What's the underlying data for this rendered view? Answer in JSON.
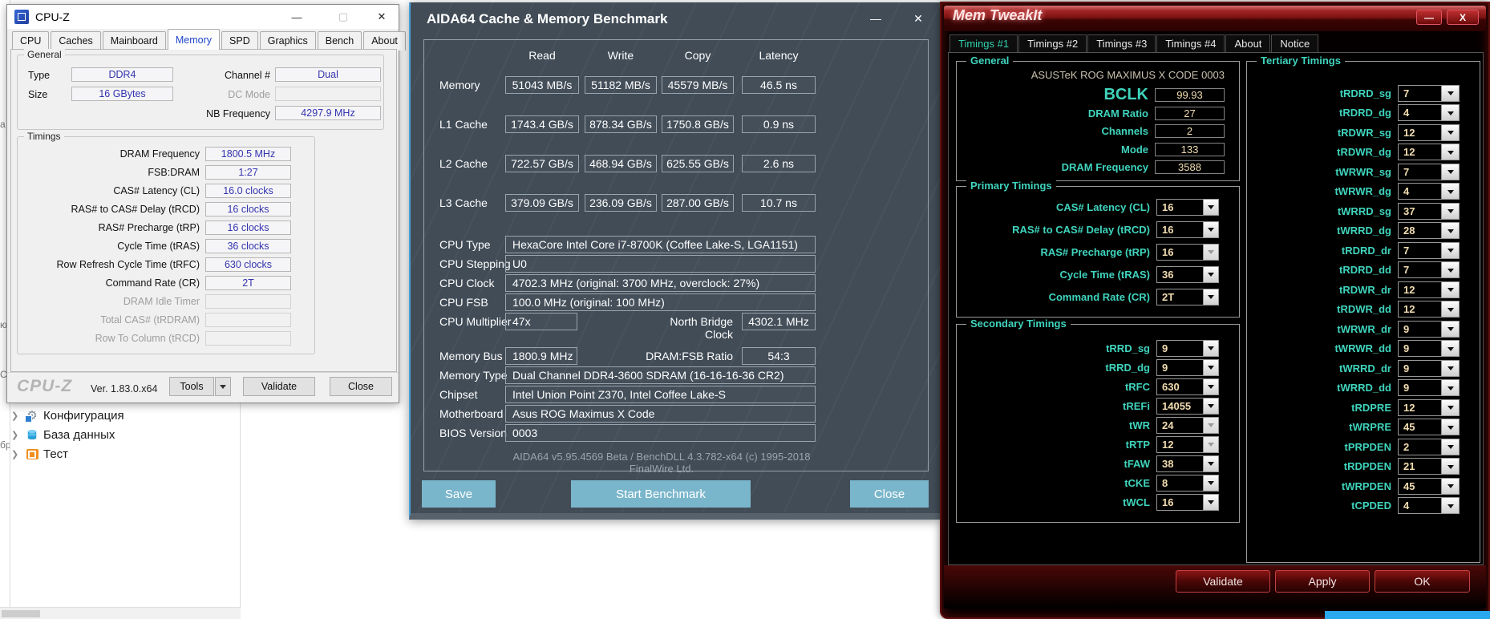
{
  "icons": {
    "minimize": "—",
    "maximize": "▢",
    "close": "✕",
    "close_x": "X",
    "dropdown": "▼",
    "chevron": "❯"
  },
  "colors": {
    "taskbar_blue": "#29a8ee",
    "aida_button": "#7ab6cb",
    "mti_teal": "#3fd4bd",
    "mti_value": "#f2ddb0",
    "cpuz_value": "#3434ae"
  },
  "bg": {
    "fragments": [
      "a",
      "ю",
      "CI",
      "бр"
    ],
    "tree": [
      {
        "label": "Конфигурация"
      },
      {
        "label": "База данных"
      },
      {
        "label": "Тест"
      }
    ]
  },
  "cpuz": {
    "title": "CPU-Z",
    "tabs": [
      "CPU",
      "Caches",
      "Mainboard",
      "Memory",
      "SPD",
      "Graphics",
      "Bench",
      "About"
    ],
    "general_label": "General",
    "type_label": "Type",
    "type_value": "DDR4",
    "size_label": "Size",
    "size_value": "16 GBytes",
    "channel_label": "Channel #",
    "channel_value": "Dual",
    "dc_label": "DC Mode",
    "nb_label": "NB Frequency",
    "nb_value": "4297.9 MHz",
    "timings_label": "Timings",
    "timings": [
      {
        "label": "DRAM Frequency",
        "value": "1800.5 MHz"
      },
      {
        "label": "FSB:DRAM",
        "value": "1:27"
      },
      {
        "label": "CAS# Latency (CL)",
        "value": "16.0 clocks"
      },
      {
        "label": "RAS# to CAS# Delay (tRCD)",
        "value": "16 clocks"
      },
      {
        "label": "RAS# Precharge (tRP)",
        "value": "16 clocks"
      },
      {
        "label": "Cycle Time (tRAS)",
        "value": "36 clocks"
      },
      {
        "label": "Row Refresh Cycle Time (tRFC)",
        "value": "630 clocks"
      },
      {
        "label": "Command Rate (CR)",
        "value": "2T"
      },
      {
        "label": "DRAM Idle Timer",
        "value": ""
      },
      {
        "label": "Total CAS# (tRDRAM)",
        "value": ""
      },
      {
        "label": "Row To Column (tRCD)",
        "value": ""
      }
    ],
    "logo": "CPU-Z",
    "version": "Ver. 1.83.0.x64",
    "tools": "Tools",
    "validate": "Validate",
    "close": "Close"
  },
  "aida": {
    "title": "AIDA64 Cache & Memory Benchmark",
    "headers": [
      "Read",
      "Write",
      "Copy",
      "Latency"
    ],
    "bench": [
      {
        "label": "Memory",
        "v0": "51043 MB/s",
        "v1": "51182 MB/s",
        "v2": "45579 MB/s",
        "v3": "46.5 ns"
      },
      {
        "label": "L1 Cache",
        "v0": "1743.4 GB/s",
        "v1": "878.34 GB/s",
        "v2": "1750.8 GB/s",
        "v3": "0.9 ns"
      },
      {
        "label": "L2 Cache",
        "v0": "722.57 GB/s",
        "v1": "468.94 GB/s",
        "v2": "625.55 GB/s",
        "v3": "2.6 ns"
      },
      {
        "label": "L3 Cache",
        "v0": "379.09 GB/s",
        "v1": "236.09 GB/s",
        "v2": "287.00 GB/s",
        "v3": "10.7 ns"
      }
    ],
    "info": [
      {
        "label": "CPU Type",
        "value": "HexaCore Intel Core i7-8700K  (Coffee Lake-S, LGA1151)"
      },
      {
        "label": "CPU Stepping",
        "value": "U0"
      },
      {
        "label": "CPU Clock",
        "value": "4702.3 MHz  (original: 3700 MHz, overclock: 27%)"
      },
      {
        "label": "CPU FSB",
        "value": "100.0 MHz  (original: 100 MHz)"
      },
      {
        "label": "CPU Multiplier",
        "value": "47x"
      }
    ],
    "nbc_label": "North Bridge Clock",
    "nbc_value": "4302.1 MHz",
    "membus_label": "Memory Bus",
    "membus_value": "1800.9 MHz",
    "ratio_label": "DRAM:FSB Ratio",
    "ratio_value": "54:3",
    "mem": [
      {
        "label": "Memory Type",
        "value": "Dual Channel DDR4-3600 SDRAM  (16-16-16-36 CR2)"
      },
      {
        "label": "Chipset",
        "value": "Intel Union Point Z370, Intel Coffee Lake-S"
      },
      {
        "label": "Motherboard",
        "value": "Asus ROG Maximus X Code"
      },
      {
        "label": "BIOS Version",
        "value": "0003"
      }
    ],
    "footer": "AIDA64 v5.95.4569 Beta / BenchDLL 4.3.782-x64  (c) 1995-2018 FinalWire Ltd.",
    "save": "Save",
    "start": "Start Benchmark",
    "close": "Close"
  },
  "mti": {
    "title": "Mem TweakIt",
    "tabs": [
      "Timings #1",
      "Timings #2",
      "Timings #3",
      "Timings #4",
      "About",
      "Notice"
    ],
    "general_label": "General",
    "board": "ASUSTeK ROG MAXIMUS X CODE 0003",
    "general": [
      {
        "label": "BCLK",
        "value": "99.93"
      },
      {
        "label": "DRAM Ratio",
        "value": "27"
      },
      {
        "label": "Channels",
        "value": "2"
      },
      {
        "label": "Mode",
        "value": "133"
      },
      {
        "label": "DRAM Frequency",
        "value": "3588"
      }
    ],
    "primary_label": "Primary Timings",
    "primary": [
      {
        "label": "CAS# Latency (CL)",
        "value": "16"
      },
      {
        "label": "RAS# to CAS# Delay (tRCD)",
        "value": "16"
      },
      {
        "label": "RAS# Precharge (tRP)",
        "value": "16"
      },
      {
        "label": "Cycle Time (tRAS)",
        "value": "36"
      },
      {
        "label": "Command Rate (CR)",
        "value": "2T"
      }
    ],
    "secondary_label": "Secondary Timings",
    "secondary": [
      {
        "label": "tRRD_sg",
        "value": "9"
      },
      {
        "label": "tRRD_dg",
        "value": "9"
      },
      {
        "label": "tRFC",
        "value": "630"
      },
      {
        "label": "tREFi",
        "value": "14055"
      },
      {
        "label": "tWR",
        "value": "24"
      },
      {
        "label": "tRTP",
        "value": "12"
      },
      {
        "label": "tFAW",
        "value": "38"
      },
      {
        "label": "tCKE",
        "value": "8"
      },
      {
        "label": "tWCL",
        "value": "16"
      }
    ],
    "tertiary_label": "Tertiary Timings",
    "tertiary": [
      {
        "label": "tRDRD_sg",
        "value": "7"
      },
      {
        "label": "tRDRD_dg",
        "value": "4"
      },
      {
        "label": "tRDWR_sg",
        "value": "12"
      },
      {
        "label": "tRDWR_dg",
        "value": "12"
      },
      {
        "label": "tWRWR_sg",
        "value": "7"
      },
      {
        "label": "tWRWR_dg",
        "value": "4"
      },
      {
        "label": "tWRRD_sg",
        "value": "37"
      },
      {
        "label": "tWRRD_dg",
        "value": "28"
      },
      {
        "label": "tRDRD_dr",
        "value": "7"
      },
      {
        "label": "tRDRD_dd",
        "value": "7"
      },
      {
        "label": "tRDWR_dr",
        "value": "12"
      },
      {
        "label": "tRDWR_dd",
        "value": "12"
      },
      {
        "label": "tWRWR_dr",
        "value": "9"
      },
      {
        "label": "tWRWR_dd",
        "value": "9"
      },
      {
        "label": "tWRRD_dr",
        "value": "9"
      },
      {
        "label": "tWRRD_dd",
        "value": "9"
      },
      {
        "label": "tRDPRE",
        "value": "12"
      },
      {
        "label": "tWRPRE",
        "value": "45"
      },
      {
        "label": "tPRPDEN",
        "value": "2"
      },
      {
        "label": "tRDPDEN",
        "value": "21"
      },
      {
        "label": "tWRPDEN",
        "value": "45"
      },
      {
        "label": "tCPDED",
        "value": "4"
      }
    ],
    "validate": "Validate",
    "apply": "Apply",
    "ok": "OK"
  }
}
